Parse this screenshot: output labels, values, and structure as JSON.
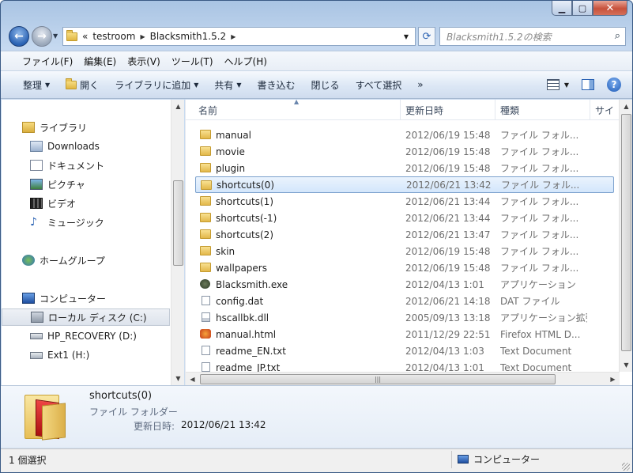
{
  "window": {
    "caption_min": "▁",
    "caption_max": "▢",
    "caption_close": "✕"
  },
  "address": {
    "overflow": "«",
    "crumbs": [
      "testroom",
      "Blacksmith1.5.2"
    ],
    "search_placeholder": "Blacksmith1.5.2の検索"
  },
  "menu": [
    "ファイル(F)",
    "編集(E)",
    "表示(V)",
    "ツール(T)",
    "ヘルプ(H)"
  ],
  "commands": {
    "organize": "整理",
    "open": "開く",
    "add_library": "ライブラリに追加",
    "share": "共有",
    "burn": "書き込む",
    "close": "閉じる",
    "select_all": "すべて選択",
    "more": "»"
  },
  "nav": {
    "libraries": "ライブラリ",
    "downloads": "Downloads",
    "documents": "ドキュメント",
    "pictures": "ピクチャ",
    "videos": "ビデオ",
    "music": "ミュージック",
    "homegroup": "ホームグループ",
    "computer": "コンピューター",
    "local_disk": "ローカル ディスク (C:)",
    "recovery": "HP_RECOVERY (D:)",
    "ext1": "Ext1 (H:)"
  },
  "columns": {
    "name": "名前",
    "modified": "更新日時",
    "type": "種類",
    "size": "サイ"
  },
  "files": [
    {
      "name": "manual",
      "date": "2012/06/19 15:48",
      "type": "ファイル フォル...",
      "icon": "folder"
    },
    {
      "name": "movie",
      "date": "2012/06/19 15:48",
      "type": "ファイル フォル...",
      "icon": "folder"
    },
    {
      "name": "plugin",
      "date": "2012/06/19 15:48",
      "type": "ファイル フォル...",
      "icon": "folder"
    },
    {
      "name": "shortcuts(0)",
      "date": "2012/06/21 13:42",
      "type": "ファイル フォル...",
      "icon": "folder"
    },
    {
      "name": "shortcuts(1)",
      "date": "2012/06/21 13:44",
      "type": "ファイル フォル...",
      "icon": "folder"
    },
    {
      "name": "shortcuts(-1)",
      "date": "2012/06/21 13:44",
      "type": "ファイル フォル...",
      "icon": "folder"
    },
    {
      "name": "shortcuts(2)",
      "date": "2012/06/21 13:47",
      "type": "ファイル フォル...",
      "icon": "folder"
    },
    {
      "name": "skin",
      "date": "2012/06/19 15:48",
      "type": "ファイル フォル...",
      "icon": "folder"
    },
    {
      "name": "wallpapers",
      "date": "2012/06/19 15:48",
      "type": "ファイル フォル...",
      "icon": "folder"
    },
    {
      "name": "Blacksmith.exe",
      "date": "2012/04/13 1:01",
      "type": "アプリケーション",
      "icon": "exe"
    },
    {
      "name": "config.dat",
      "date": "2012/06/21 14:18",
      "type": "DAT ファイル",
      "icon": "doc"
    },
    {
      "name": "hscallbk.dll",
      "date": "2005/09/13 13:18",
      "type": "アプリケーション拡張",
      "icon": "dll"
    },
    {
      "name": "manual.html",
      "date": "2011/12/29 22:51",
      "type": "Firefox HTML D...",
      "icon": "html"
    },
    {
      "name": "readme_EN.txt",
      "date": "2012/04/13 1:03",
      "type": "Text Document",
      "icon": "doc"
    },
    {
      "name": "readme_JP.txt",
      "date": "2012/04/13 1:01",
      "type": "Text Document",
      "icon": "doc"
    }
  ],
  "details": {
    "name": "shortcuts(0)",
    "type": "ファイル フォルダー",
    "modified_label": "更新日時:",
    "modified_value": "2012/06/21 13:42"
  },
  "status": {
    "selection": "1 個選択",
    "location": "コンピューター"
  }
}
